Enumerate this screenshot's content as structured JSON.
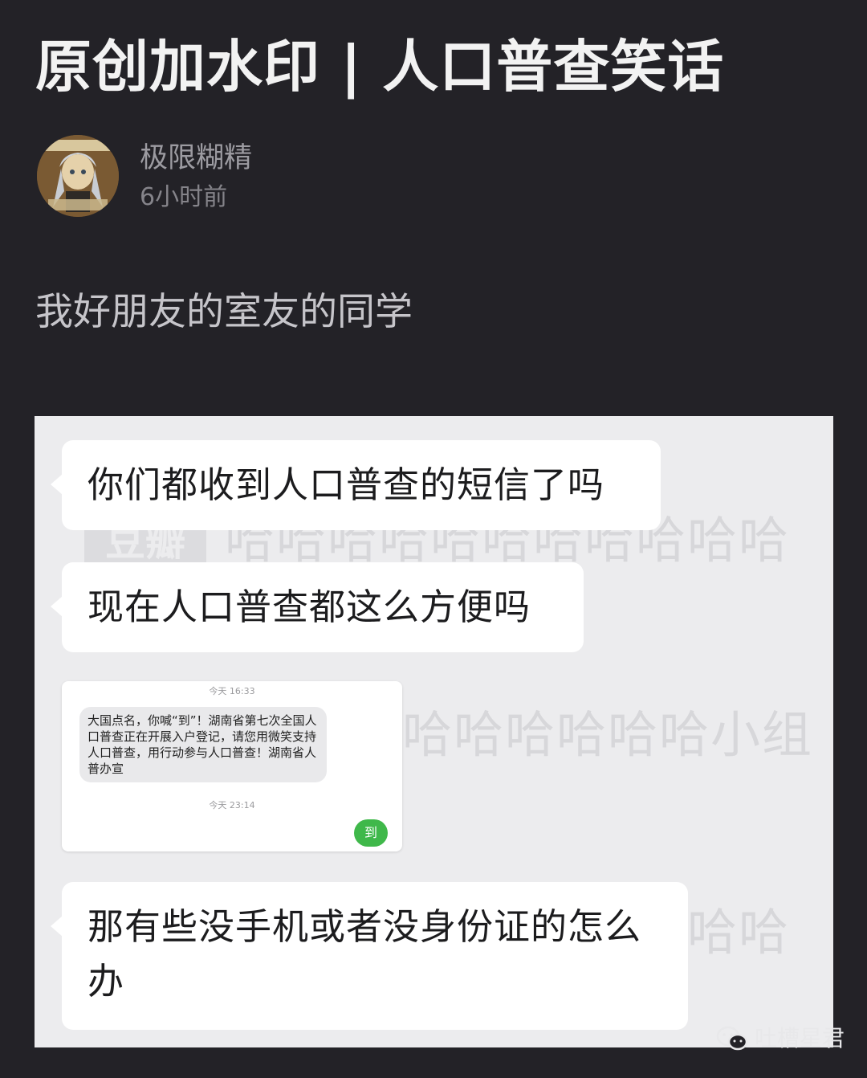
{
  "post": {
    "title": "原创加水印 | 人口普查笑话",
    "author": "极限糊精",
    "time": "6小时前",
    "body": "我好朋友的室友的同学"
  },
  "screenshot": {
    "messages": [
      {
        "text": "你们都收到人口普查的短信了吗"
      },
      {
        "text": "现在人口普查都这么方便吗"
      },
      {
        "text": "那有些没手机或者没身份证的怎么办"
      }
    ],
    "image_message": {
      "time_top": "今天 16:33",
      "sms_text": "大国点名，你喊“到”！湖南省第七次全国人口普查正在开展入户登记，请您用微笑支持人口普查，用行动参与人口普查！湖南省人普办宣",
      "time_bottom": "今天 23:14",
      "reply": "到"
    },
    "watermark": {
      "logo": "豆瓣",
      "line1": "哈哈哈哈哈哈哈哈哈哈哈",
      "line2": "哈哈哈哈哈哈哈哈小组",
      "line3": "哈哈哈哈哈哈哈哈哈哈哈"
    }
  },
  "footer": {
    "brand": "吐槽星君",
    "icon": "wechat-icon"
  },
  "colors": {
    "page_bg": "#232227",
    "title_text": "#f2f2f2",
    "meta_text": "#9c9ba1",
    "screenshot_bg": "#ececee",
    "bubble_bg": "#ffffff",
    "reply_green": "#3fb84a"
  }
}
